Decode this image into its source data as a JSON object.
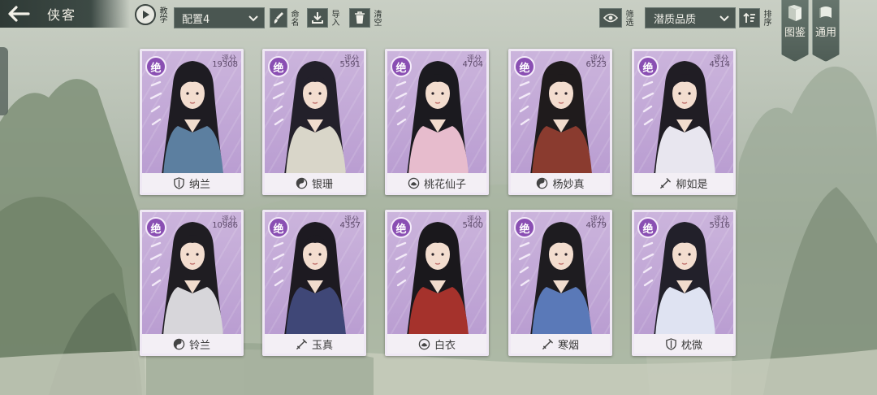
{
  "header": {
    "title": "侠客",
    "teach_label": "教学",
    "config_value": "配置4",
    "rename_label": "命名",
    "import_label": "导入",
    "clear_label": "清空",
    "filter_label": "筛选",
    "quality_value": "潜质品质",
    "sort_label": "排序"
  },
  "side_tabs": [
    {
      "label": "图鉴",
      "icon": "book-icon"
    },
    {
      "label": "通用",
      "icon": "scroll-icon"
    }
  ],
  "colors": {
    "card_purple": "#b79ad0",
    "grade_purple": "#8a4fb3",
    "topbar_dark": "#3d4a45"
  },
  "cards": [
    {
      "grade": "绝",
      "score_label": "评分",
      "score": "19308",
      "name": "纳兰",
      "type_icon": "shield-icon"
    },
    {
      "grade": "绝",
      "score_label": "评分",
      "score": "5591",
      "name": "银珊",
      "type_icon": "yin-yang-icon"
    },
    {
      "grade": "绝",
      "score_label": "评分",
      "score": "4704",
      "name": "桃花仙子",
      "type_icon": "lotus-icon"
    },
    {
      "grade": "绝",
      "score_label": "评分",
      "score": "6523",
      "name": "杨妙真",
      "type_icon": "yin-yang-icon"
    },
    {
      "grade": "绝",
      "score_label": "评分",
      "score": "4514",
      "name": "柳如是",
      "type_icon": "sword-icon"
    },
    {
      "grade": "绝",
      "score_label": "评分",
      "score": "10986",
      "name": "铃兰",
      "type_icon": "yin-yang-icon"
    },
    {
      "grade": "绝",
      "score_label": "评分",
      "score": "4357",
      "name": "玉真",
      "type_icon": "sword-icon"
    },
    {
      "grade": "绝",
      "score_label": "评分",
      "score": "5400",
      "name": "白衣",
      "type_icon": "lotus-icon"
    },
    {
      "grade": "绝",
      "score_label": "评分",
      "score": "4679",
      "name": "寒烟",
      "type_icon": "sword-icon"
    },
    {
      "grade": "绝",
      "score_label": "评分",
      "score": "5916",
      "name": "枕微",
      "type_icon": "shield-icon"
    }
  ]
}
